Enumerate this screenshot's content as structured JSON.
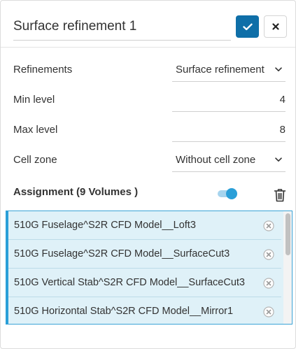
{
  "header": {
    "title": "Surface refinement 1",
    "confirm_icon": "check-icon",
    "close_icon": "close-icon"
  },
  "form": {
    "refinements": {
      "label": "Refinements",
      "value": "Surface refinement"
    },
    "min_level": {
      "label": "Min level",
      "value": "4"
    },
    "max_level": {
      "label": "Max level",
      "value": "8"
    },
    "cell_zone": {
      "label": "Cell zone",
      "value": "Without cell zone"
    }
  },
  "assignment": {
    "label": "Assignment (9 Volumes )",
    "toggle_on": true,
    "items": [
      {
        "label": "510G Fuselage^S2R CFD Model__Loft3"
      },
      {
        "label": "510G Fuselage^S2R CFD Model__SurfaceCut3"
      },
      {
        "label": "510G Vertical Stab^S2R CFD Model__SurfaceCut3"
      },
      {
        "label": "510G Horizontal Stab^S2R CFD Model__Mirror1"
      }
    ]
  },
  "colors": {
    "primary": "#0f6fa8",
    "accent": "#2a9fd8",
    "selection_bg": "#dff1f8"
  }
}
